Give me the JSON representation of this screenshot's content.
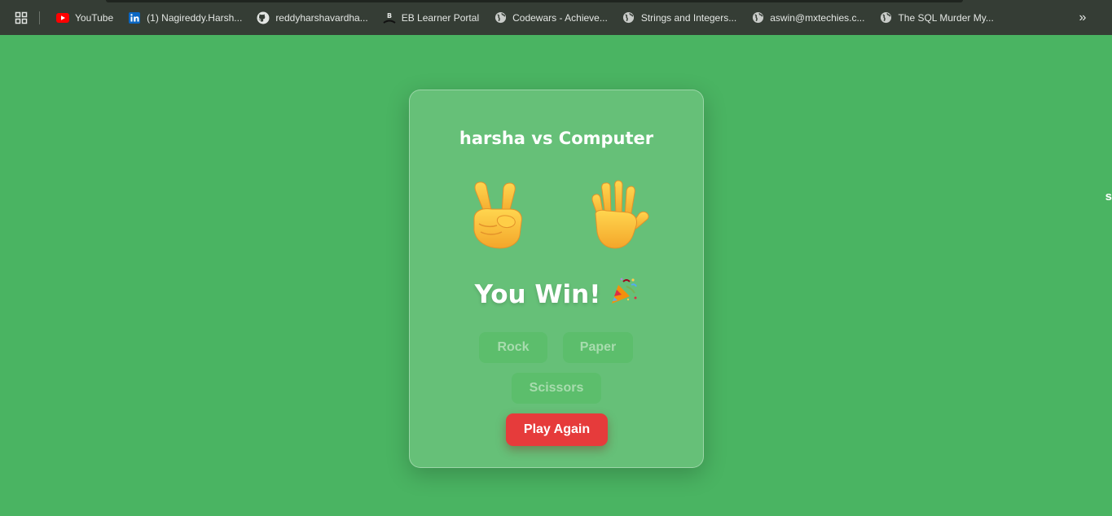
{
  "bookmarks": {
    "items": [
      {
        "label": "YouTube",
        "icon": "youtube-icon"
      },
      {
        "label": "(1) Nagireddy.Harsh...",
        "icon": "linkedin-icon"
      },
      {
        "label": "reddyharshavardha...",
        "icon": "github-icon"
      },
      {
        "label": "EB Learner Portal",
        "icon": "eb-logo-icon"
      },
      {
        "label": "Codewars - Achieve...",
        "icon": "globe-icon"
      },
      {
        "label": "Strings and Integers...",
        "icon": "globe-icon"
      },
      {
        "label": "aswin@mxtechies.c...",
        "icon": "globe-icon"
      },
      {
        "label": "The SQL Murder My...",
        "icon": "globe-icon"
      }
    ],
    "overflow_glyph": "»"
  },
  "edge_text": "s",
  "game": {
    "title": "harsha vs Computer",
    "player_hand": "victory-hand-emoji",
    "computer_hand": "raised-hand-emoji",
    "result": "You Win!",
    "result_icon": "party-popper-icon",
    "choices": [
      "Rock",
      "Paper",
      "Scissors"
    ],
    "play_again": "Play Again"
  },
  "colors": {
    "background": "#4ab462",
    "card": "#66c078",
    "bookmarks_bar": "#353d35",
    "play_again": "#e63b3b",
    "choice_button": "#5cbe6c"
  }
}
